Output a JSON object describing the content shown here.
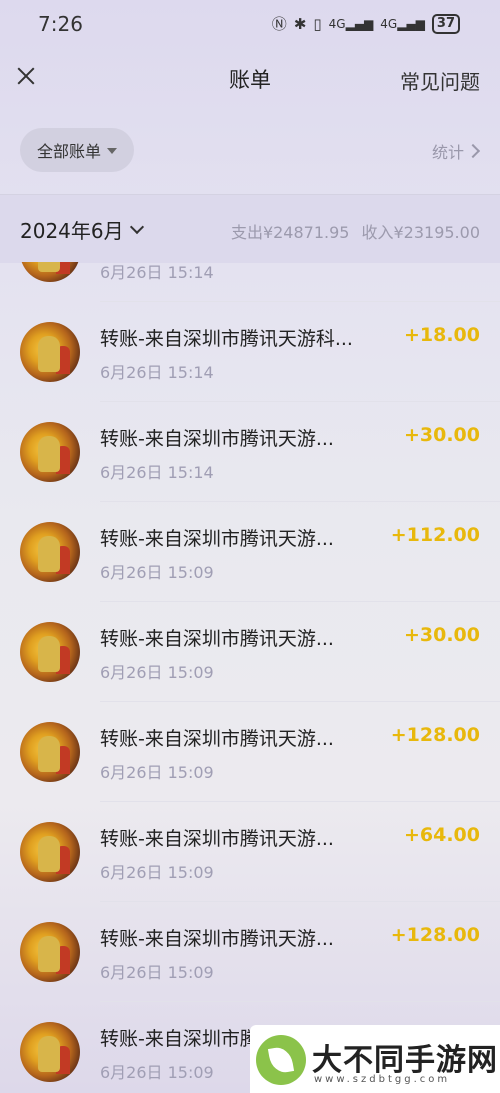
{
  "status_bar": {
    "time": "7:26",
    "battery": "37",
    "signal1": "4G",
    "signal2": "4G"
  },
  "header": {
    "title": "账单",
    "faq": "常见问题"
  },
  "filter": {
    "label": "全部账单",
    "stats": "统计"
  },
  "month": {
    "label": "2024年6月",
    "expense": "支出¥24871.95",
    "income": "收入¥23195.00"
  },
  "transactions": [
    {
      "title": "",
      "time": "6月26日 15:14",
      "amount": ""
    },
    {
      "title": "转账-来自深圳市腾讯天游科...",
      "time": "6月26日 15:14",
      "amount": "+18.00"
    },
    {
      "title": "转账-来自深圳市腾讯天游...",
      "time": "6月26日 15:14",
      "amount": "+30.00"
    },
    {
      "title": "转账-来自深圳市腾讯天游...",
      "time": "6月26日 15:09",
      "amount": "+112.00"
    },
    {
      "title": "转账-来自深圳市腾讯天游...",
      "time": "6月26日 15:09",
      "amount": "+30.00"
    },
    {
      "title": "转账-来自深圳市腾讯天游...",
      "time": "6月26日 15:09",
      "amount": "+128.00"
    },
    {
      "title": "转账-来自深圳市腾讯天游...",
      "time": "6月26日 15:09",
      "amount": "+64.00"
    },
    {
      "title": "转账-来自深圳市腾讯天游...",
      "time": "6月26日 15:09",
      "amount": "+128.00"
    },
    {
      "title": "转账-来自深圳市腾讯天游...",
      "time": "6月26日 15:09",
      "amount": ""
    }
  ],
  "watermark": {
    "text": "大不同手游网",
    "url": "www.szdbtgg.com"
  },
  "colors": {
    "income": "#e8b80c",
    "muted": "#a09eb4"
  }
}
